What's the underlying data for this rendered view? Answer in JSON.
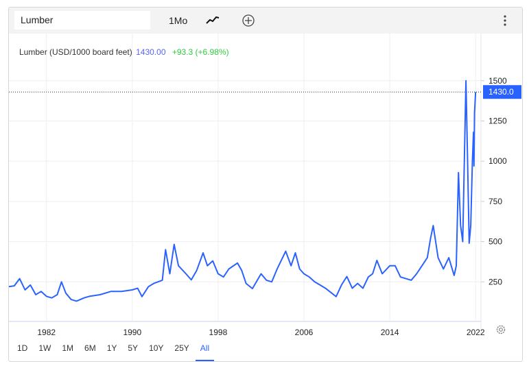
{
  "toolbar": {
    "symbol": "Lumber",
    "interval": "1Mo",
    "style_icon": "line-chart-icon",
    "add_icon": "plus-circle-icon",
    "menu_icon": "more-vertical-icon"
  },
  "legend": {
    "title": "Lumber (USD/1000 board feet)",
    "price": "1430.00",
    "change": "+93.3 (+6.98%)"
  },
  "range_buttons": [
    "1D",
    "1W",
    "1M",
    "6M",
    "1Y",
    "5Y",
    "10Y",
    "25Y",
    "All"
  ],
  "active_range": "All",
  "colors": {
    "line": "#2962ff",
    "change": "#2ecc40",
    "price_text": "#5965f5"
  },
  "chart_data": {
    "type": "line",
    "title": "Lumber (USD/1000 board feet)",
    "xlabel": "",
    "ylabel": "",
    "x_ticks": [
      "1982",
      "1990",
      "1998",
      "2006",
      "2014",
      "2022"
    ],
    "y_ticks": [
      "250",
      "500",
      "750",
      "1000",
      "1250",
      "1500"
    ],
    "xlim": [
      1978.5,
      2022.5
    ],
    "ylim": [
      4,
      1742
    ],
    "last_value_label": "1430.0",
    "grid": true,
    "series": [
      {
        "name": "Lumber",
        "x": [
          1978.5,
          1979,
          1979.5,
          1980,
          1980.5,
          1981,
          1981.5,
          1982,
          1982.5,
          1983,
          1983.4,
          1983.8,
          1984.3,
          1984.8,
          1985.5,
          1986,
          1987,
          1988,
          1989,
          1990,
          1990.5,
          1990.9,
          1991.5,
          1992,
          1992.8,
          1993.1,
          1993.5,
          1993.9,
          1994.3,
          1995,
          1995.5,
          1996,
          1996.6,
          1997,
          1997.5,
          1998,
          1998.5,
          1999,
          1999.8,
          2000.2,
          2000.6,
          2001.2,
          2002,
          2002.5,
          2003,
          2003.5,
          2004.3,
          2004.8,
          2005.2,
          2005.6,
          2006,
          2006.5,
          2007,
          2007.5,
          2008,
          2009,
          2009.5,
          2010,
          2010.5,
          2011,
          2011.5,
          2012,
          2012.4,
          2012.8,
          2013.3,
          2014,
          2014.5,
          2015,
          2016,
          2016.5,
          2017,
          2017.5,
          2017.8,
          2018.05,
          2018.5,
          2019,
          2019.5,
          2020,
          2020.2,
          2020.4,
          2020.6,
          2020.8,
          2021.1,
          2021.25,
          2021.4,
          2021.55,
          2021.7,
          2021.8,
          2021.85,
          2021.9,
          2022.0
        ],
        "y": [
          220,
          225,
          270,
          200,
          230,
          170,
          190,
          160,
          150,
          170,
          250,
          180,
          140,
          130,
          150,
          160,
          170,
          190,
          190,
          200,
          210,
          158,
          220,
          240,
          260,
          450,
          300,
          483,
          350,
          300,
          262,
          320,
          430,
          350,
          380,
          300,
          280,
          330,
          367,
          320,
          240,
          208,
          300,
          260,
          250,
          330,
          440,
          350,
          430,
          330,
          300,
          280,
          250,
          230,
          210,
          158,
          230,
          283,
          210,
          240,
          210,
          280,
          300,
          383,
          300,
          350,
          350,
          280,
          260,
          300,
          350,
          400,
          520,
          600,
          400,
          330,
          400,
          290,
          350,
          929,
          600,
          500,
          1500,
          1000,
          490,
          600,
          1000,
          1180,
          970,
          1300,
          1430
        ]
      }
    ]
  }
}
